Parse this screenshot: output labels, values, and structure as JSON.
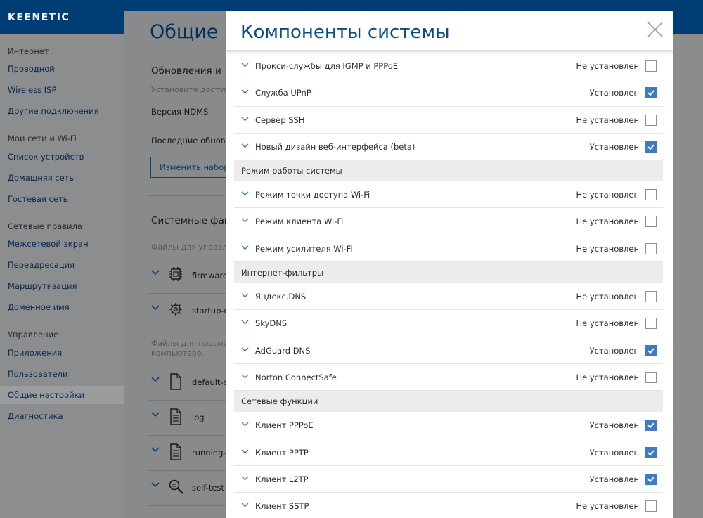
{
  "brand": {
    "logo_text": "KEENETIC"
  },
  "sidebar": {
    "sections": [
      {
        "label": "Интернет",
        "items": [
          {
            "label": "Проводной"
          },
          {
            "label": "Wireless ISP"
          },
          {
            "label": "Другие подключения"
          }
        ]
      },
      {
        "label": "Мои сети и Wi-Fi",
        "items": [
          {
            "label": "Список устройств"
          },
          {
            "label": "Домашняя сеть"
          },
          {
            "label": "Гостевая сеть"
          }
        ]
      },
      {
        "label": "Сетевые правила",
        "items": [
          {
            "label": "Межсетевой экран"
          },
          {
            "label": "Переадресация"
          },
          {
            "label": "Маршрутизация"
          },
          {
            "label": "Доменное имя"
          }
        ]
      },
      {
        "label": "Управление",
        "items": [
          {
            "label": "Приложения"
          },
          {
            "label": "Пользователи"
          },
          {
            "label": "Общие настройки",
            "active": true
          },
          {
            "label": "Диагностика"
          }
        ]
      }
    ]
  },
  "settings_page": {
    "title": "Общие",
    "updates_heading": "Обновления и",
    "updates_hint": "Установите доступн",
    "version_label": "Версия NDMS",
    "last_updates_label": "Последние обновле",
    "change_button": "Изменить набор к",
    "sysfiles_heading": "Системные фай",
    "files_manage_hint": "Файлы для управле",
    "files_view_hint_1": "Файлы для просмот",
    "files_view_hint_2": "компьютере.",
    "files": [
      {
        "name": "firmware",
        "icon": "chip-icon"
      },
      {
        "name": "startup-c",
        "icon": "gear-file-icon"
      },
      {
        "name": "default-c",
        "icon": "file-icon"
      },
      {
        "name": "log",
        "icon": "text-file-icon"
      },
      {
        "name": "running-c",
        "icon": "text-file-icon"
      },
      {
        "name": "self-test",
        "icon": "search-file-icon"
      }
    ]
  },
  "modal": {
    "title": "Компоненты системы",
    "status_installed": "Установлен",
    "status_not_installed": "Не установлен",
    "rows_top": [
      {
        "label": "Прокси-службы для IGMP и PPPoE",
        "status": "Не установлен",
        "checked": false
      },
      {
        "label": "Служба UPnP",
        "status": "Установлен",
        "checked": true
      },
      {
        "label": "Сервер SSH",
        "status": "Не установлен",
        "checked": false
      },
      {
        "label": "Новый дизайн веб-интерфейса (beta)",
        "status": "Установлен",
        "checked": true
      }
    ],
    "groups": [
      {
        "label": "Режим работы системы",
        "rows": [
          {
            "label": "Режим точки доступа Wi-Fi",
            "status": "Не установлен",
            "checked": false
          },
          {
            "label": "Режим клиента Wi-Fi",
            "status": "Не установлен",
            "checked": false
          },
          {
            "label": "Режим усилителя Wi-Fi",
            "status": "Не установлен",
            "checked": false
          }
        ]
      },
      {
        "label": "Интернет-фильтры",
        "rows": [
          {
            "label": "Яндекс.DNS",
            "status": "Не установлен",
            "checked": false
          },
          {
            "label": "SkyDNS",
            "status": "Не установлен",
            "checked": false
          },
          {
            "label": "AdGuard DNS",
            "status": "Установлен",
            "checked": true
          },
          {
            "label": "Norton ConnectSafe",
            "status": "Не установлен",
            "checked": false
          }
        ]
      },
      {
        "label": "Сетевые функции",
        "rows": [
          {
            "label": "Клиент PPPoE",
            "status": "Установлен",
            "checked": true
          },
          {
            "label": "Клиент PPTP",
            "status": "Установлен",
            "checked": true
          },
          {
            "label": "Клиент L2TP",
            "status": "Установлен",
            "checked": true
          },
          {
            "label": "Клиент SSTP",
            "status": "Не установлен",
            "checked": false
          }
        ]
      }
    ]
  },
  "colors": {
    "header": "#013d75",
    "accent": "#3f7cbf",
    "title": "#0d4b84"
  }
}
